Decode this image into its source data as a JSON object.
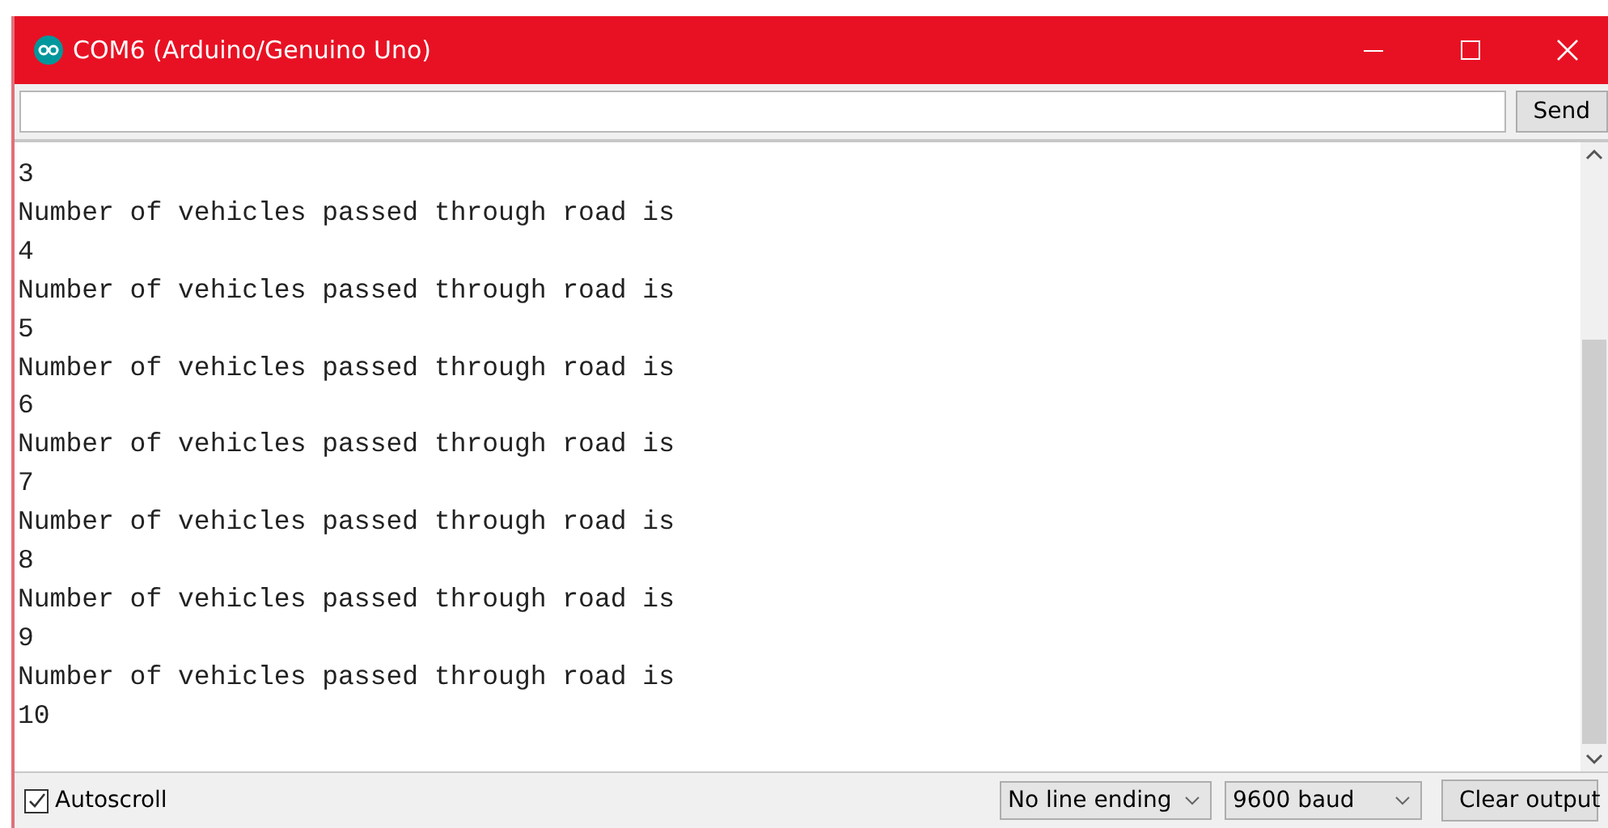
{
  "window": {
    "title": "COM6 (Arduino/Genuino Uno)"
  },
  "input": {
    "send_label": "Send"
  },
  "output_lines": [
    "3",
    "Number of vehicles passed through road is",
    "4",
    "Number of vehicles passed through road is",
    "5",
    "Number of vehicles passed through road is",
    "6",
    "Number of vehicles passed through road is",
    "7",
    "Number of vehicles passed through road is",
    "8",
    "Number of vehicles passed through road is",
    "9",
    "Number of vehicles passed through road is",
    "10"
  ],
  "footer": {
    "autoscroll": {
      "label": "Autoscroll",
      "checked": true
    },
    "line_ending": "No line ending",
    "baud": "9600 baud",
    "clear_label": "Clear output"
  }
}
